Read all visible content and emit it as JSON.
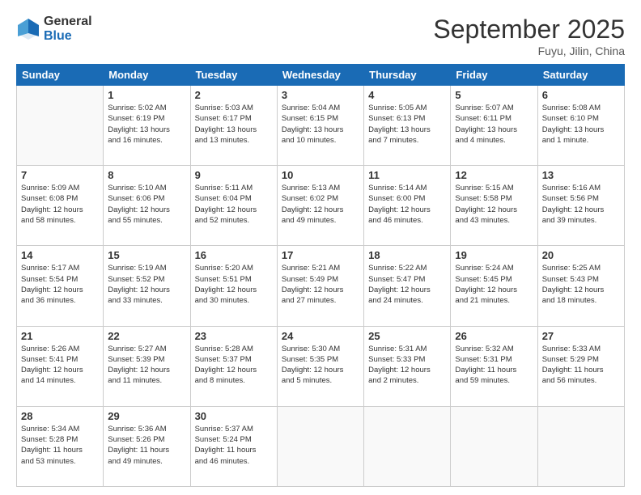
{
  "logo": {
    "general": "General",
    "blue": "Blue"
  },
  "title": "September 2025",
  "location": "Fuyu, Jilin, China",
  "days_header": [
    "Sunday",
    "Monday",
    "Tuesday",
    "Wednesday",
    "Thursday",
    "Friday",
    "Saturday"
  ],
  "weeks": [
    [
      {
        "day": "",
        "info": ""
      },
      {
        "day": "1",
        "info": "Sunrise: 5:02 AM\nSunset: 6:19 PM\nDaylight: 13 hours\nand 16 minutes."
      },
      {
        "day": "2",
        "info": "Sunrise: 5:03 AM\nSunset: 6:17 PM\nDaylight: 13 hours\nand 13 minutes."
      },
      {
        "day": "3",
        "info": "Sunrise: 5:04 AM\nSunset: 6:15 PM\nDaylight: 13 hours\nand 10 minutes."
      },
      {
        "day": "4",
        "info": "Sunrise: 5:05 AM\nSunset: 6:13 PM\nDaylight: 13 hours\nand 7 minutes."
      },
      {
        "day": "5",
        "info": "Sunrise: 5:07 AM\nSunset: 6:11 PM\nDaylight: 13 hours\nand 4 minutes."
      },
      {
        "day": "6",
        "info": "Sunrise: 5:08 AM\nSunset: 6:10 PM\nDaylight: 13 hours\nand 1 minute."
      }
    ],
    [
      {
        "day": "7",
        "info": "Sunrise: 5:09 AM\nSunset: 6:08 PM\nDaylight: 12 hours\nand 58 minutes."
      },
      {
        "day": "8",
        "info": "Sunrise: 5:10 AM\nSunset: 6:06 PM\nDaylight: 12 hours\nand 55 minutes."
      },
      {
        "day": "9",
        "info": "Sunrise: 5:11 AM\nSunset: 6:04 PM\nDaylight: 12 hours\nand 52 minutes."
      },
      {
        "day": "10",
        "info": "Sunrise: 5:13 AM\nSunset: 6:02 PM\nDaylight: 12 hours\nand 49 minutes."
      },
      {
        "day": "11",
        "info": "Sunrise: 5:14 AM\nSunset: 6:00 PM\nDaylight: 12 hours\nand 46 minutes."
      },
      {
        "day": "12",
        "info": "Sunrise: 5:15 AM\nSunset: 5:58 PM\nDaylight: 12 hours\nand 43 minutes."
      },
      {
        "day": "13",
        "info": "Sunrise: 5:16 AM\nSunset: 5:56 PM\nDaylight: 12 hours\nand 39 minutes."
      }
    ],
    [
      {
        "day": "14",
        "info": "Sunrise: 5:17 AM\nSunset: 5:54 PM\nDaylight: 12 hours\nand 36 minutes."
      },
      {
        "day": "15",
        "info": "Sunrise: 5:19 AM\nSunset: 5:52 PM\nDaylight: 12 hours\nand 33 minutes."
      },
      {
        "day": "16",
        "info": "Sunrise: 5:20 AM\nSunset: 5:51 PM\nDaylight: 12 hours\nand 30 minutes."
      },
      {
        "day": "17",
        "info": "Sunrise: 5:21 AM\nSunset: 5:49 PM\nDaylight: 12 hours\nand 27 minutes."
      },
      {
        "day": "18",
        "info": "Sunrise: 5:22 AM\nSunset: 5:47 PM\nDaylight: 12 hours\nand 24 minutes."
      },
      {
        "day": "19",
        "info": "Sunrise: 5:24 AM\nSunset: 5:45 PM\nDaylight: 12 hours\nand 21 minutes."
      },
      {
        "day": "20",
        "info": "Sunrise: 5:25 AM\nSunset: 5:43 PM\nDaylight: 12 hours\nand 18 minutes."
      }
    ],
    [
      {
        "day": "21",
        "info": "Sunrise: 5:26 AM\nSunset: 5:41 PM\nDaylight: 12 hours\nand 14 minutes."
      },
      {
        "day": "22",
        "info": "Sunrise: 5:27 AM\nSunset: 5:39 PM\nDaylight: 12 hours\nand 11 minutes."
      },
      {
        "day": "23",
        "info": "Sunrise: 5:28 AM\nSunset: 5:37 PM\nDaylight: 12 hours\nand 8 minutes."
      },
      {
        "day": "24",
        "info": "Sunrise: 5:30 AM\nSunset: 5:35 PM\nDaylight: 12 hours\nand 5 minutes."
      },
      {
        "day": "25",
        "info": "Sunrise: 5:31 AM\nSunset: 5:33 PM\nDaylight: 12 hours\nand 2 minutes."
      },
      {
        "day": "26",
        "info": "Sunrise: 5:32 AM\nSunset: 5:31 PM\nDaylight: 11 hours\nand 59 minutes."
      },
      {
        "day": "27",
        "info": "Sunrise: 5:33 AM\nSunset: 5:29 PM\nDaylight: 11 hours\nand 56 minutes."
      }
    ],
    [
      {
        "day": "28",
        "info": "Sunrise: 5:34 AM\nSunset: 5:28 PM\nDaylight: 11 hours\nand 53 minutes."
      },
      {
        "day": "29",
        "info": "Sunrise: 5:36 AM\nSunset: 5:26 PM\nDaylight: 11 hours\nand 49 minutes."
      },
      {
        "day": "30",
        "info": "Sunrise: 5:37 AM\nSunset: 5:24 PM\nDaylight: 11 hours\nand 46 minutes."
      },
      {
        "day": "",
        "info": ""
      },
      {
        "day": "",
        "info": ""
      },
      {
        "day": "",
        "info": ""
      },
      {
        "day": "",
        "info": ""
      }
    ]
  ]
}
